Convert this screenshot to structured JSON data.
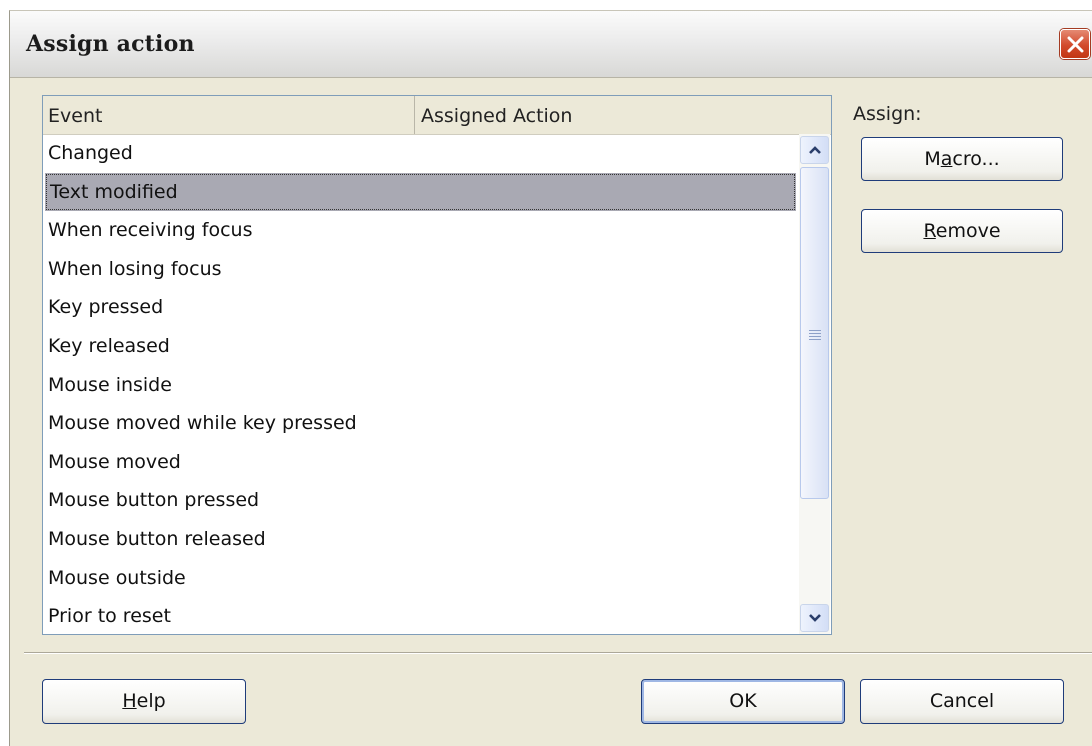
{
  "window": {
    "title": "Assign action"
  },
  "list": {
    "columns": [
      {
        "label": "Event"
      },
      {
        "label": "Assigned Action"
      }
    ],
    "rows": [
      {
        "event": "Changed",
        "action": ""
      },
      {
        "event": "Text modified",
        "action": ""
      },
      {
        "event": "When receiving focus",
        "action": ""
      },
      {
        "event": "When losing focus",
        "action": ""
      },
      {
        "event": "Key pressed",
        "action": ""
      },
      {
        "event": "Key released",
        "action": ""
      },
      {
        "event": "Mouse inside",
        "action": ""
      },
      {
        "event": "Mouse moved while key pressed",
        "action": ""
      },
      {
        "event": "Mouse moved",
        "action": ""
      },
      {
        "event": "Mouse button pressed",
        "action": ""
      },
      {
        "event": "Mouse button released",
        "action": ""
      },
      {
        "event": "Mouse outside",
        "action": ""
      },
      {
        "event": "Prior to reset",
        "action": ""
      }
    ],
    "selected_row": "Text modified"
  },
  "assign": {
    "label": "Assign:",
    "macro_button": {
      "prefix": "M",
      "mnemonic": "a",
      "suffix": "cro..."
    },
    "remove_button": {
      "prefix": "",
      "mnemonic": "R",
      "suffix": "emove"
    }
  },
  "footer": {
    "help_button": {
      "prefix": "",
      "mnemonic": "H",
      "suffix": "elp"
    },
    "ok_button": "OK",
    "cancel_button": "Cancel"
  },
  "colors": {
    "dialog_bg": "#ece9d8",
    "selection_bg": "#a9a9b3",
    "close_button": "#d24a2c",
    "button_border": "#1f3c7a"
  }
}
